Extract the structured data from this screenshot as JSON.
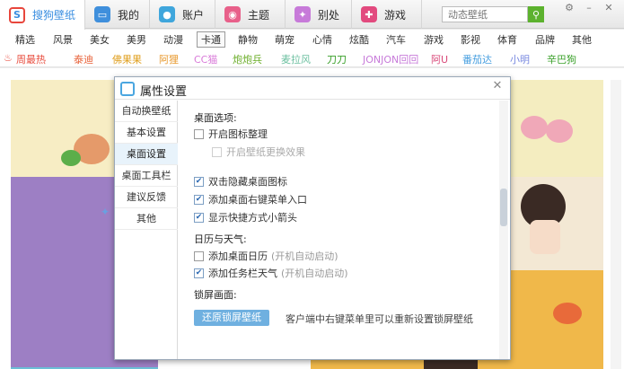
{
  "search": {
    "placeholder": "动态壁纸"
  },
  "tabs": [
    {
      "label": "搜狗壁纸",
      "icon": "sogou-logo-icon"
    },
    {
      "label": "我的",
      "icon": "monitor-icon"
    },
    {
      "label": "账户",
      "icon": "user-icon"
    },
    {
      "label": "主题",
      "icon": "theme-icon"
    },
    {
      "label": "别处",
      "icon": "butterfly-icon"
    },
    {
      "label": "游戏",
      "icon": "gamepad-icon"
    }
  ],
  "categories": [
    "精选",
    "风景",
    "美女",
    "美男",
    "动漫",
    "卡通",
    "静物",
    "萌宠",
    "心情",
    "炫酷",
    "汽车",
    "游戏",
    "影视",
    "体育",
    "品牌",
    "其他"
  ],
  "active_category": "卡通",
  "star_tags": [
    "周最热",
    "泰迪",
    "佛果果",
    "阿狸",
    "CC猫",
    "炮炮兵",
    "麦拉风",
    "刀刀",
    "JONJON回回",
    "阿U",
    "番茄达",
    "小明",
    "辛巴狗"
  ],
  "dialog": {
    "title": "属性设置",
    "nav": [
      "自动换壁纸",
      "基本设置",
      "桌面设置",
      "桌面工具栏",
      "建议反馈",
      "其他"
    ],
    "active_nav": "桌面设置",
    "desktop_section": "桌面选项:",
    "options": {
      "organize": {
        "label": "开启图标整理",
        "checked": false
      },
      "effect": {
        "label": "开启壁纸更换效果",
        "checked": false
      },
      "dblclick": {
        "label": "双击隐藏桌面图标",
        "checked": true
      },
      "context_menu": {
        "label": "添加桌面右键菜单入口",
        "checked": true
      },
      "arrow": {
        "label": "显示快捷方式小箭头",
        "checked": true
      }
    },
    "weather_section": "日历与天气:",
    "weather": {
      "calendar": {
        "label": "添加桌面日历",
        "checked": false,
        "hint": "(开机自动启动)"
      },
      "taskbar": {
        "label": "添加任务栏天气",
        "checked": true,
        "hint": "(开机自动启动)"
      }
    },
    "lock_section": "锁屏画面:",
    "restore_button": "还原锁屏壁纸",
    "restore_hint": "客户端中右键菜单里可以重新设置锁屏壁纸"
  }
}
